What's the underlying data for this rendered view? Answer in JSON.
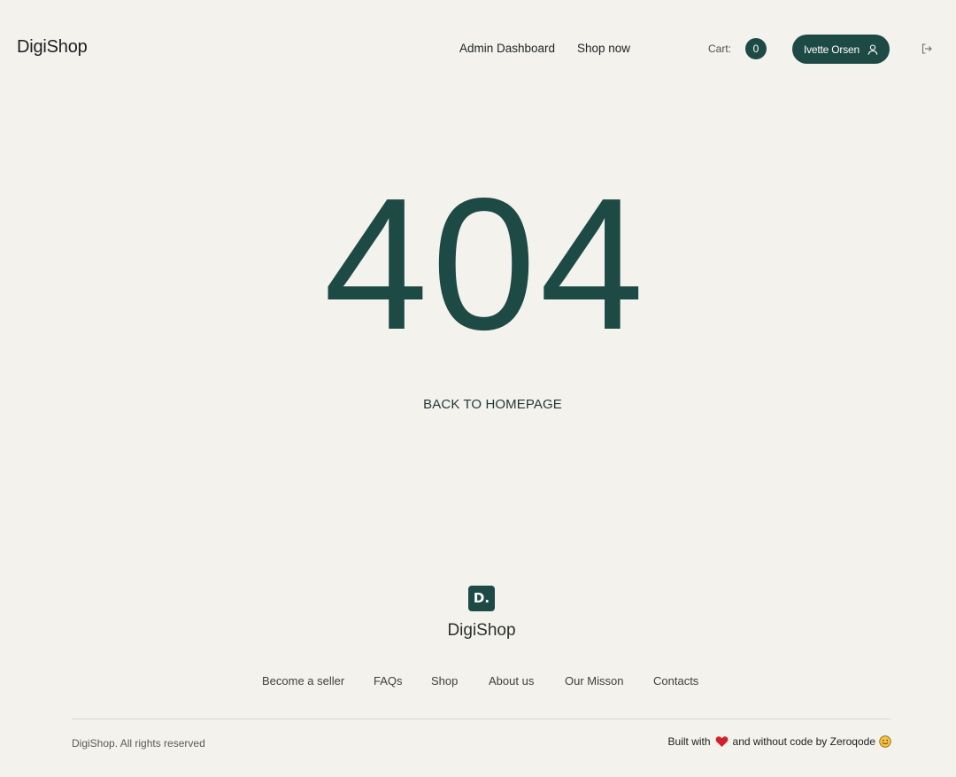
{
  "header": {
    "logo": "DigiShop",
    "nav": {
      "admin_dashboard": "Admin Dashboard",
      "shop_now": "Shop now"
    },
    "cart": {
      "label": "Cart:",
      "count": "0"
    },
    "user": {
      "name": "Ivette Orsen",
      "icon": "user-icon"
    },
    "logout_icon": "logout-icon"
  },
  "hero": {
    "code": "404",
    "back_link": "BACK TO HOMEPAGE"
  },
  "footer": {
    "mark": "D.",
    "brand": "DigiShop",
    "links": [
      "Become a seller",
      "FAQs",
      "Shop",
      "About us",
      "Our Misson",
      "Contacts"
    ],
    "copyright": "DigiShop. All rights reserved",
    "built_with": "Built with",
    "built_tail": "and without code by Zeroqode"
  },
  "colors": {
    "background": "#f4f2ed",
    "accent": "#1e4a46",
    "heart": "#d3212c"
  }
}
